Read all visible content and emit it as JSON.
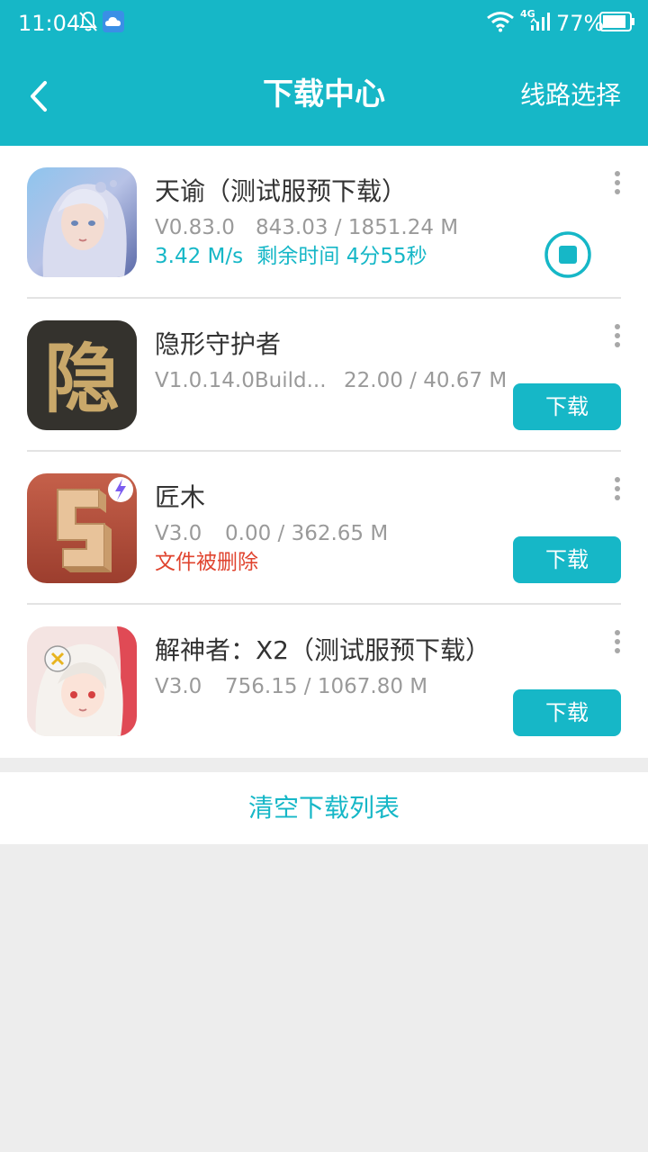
{
  "status_bar": {
    "time": "11:04",
    "network": "4G",
    "battery": "77%"
  },
  "header": {
    "title": "下载中心",
    "route_select": "线路选择"
  },
  "downloads": [
    {
      "name": "天谕（测试服预下载）",
      "version": "V0.83.0",
      "size": "843.03 / 1851.24 M",
      "speed": "3.42 M/s",
      "remaining": "剩余时间 4分55秒"
    },
    {
      "name": "隐形守护者",
      "version": "V1.0.14.0Build...",
      "size": "22.00 / 40.67 M",
      "button": "下载",
      "icon_glyph": "隐"
    },
    {
      "name": "匠木",
      "version": "V3.0",
      "size": "0.00 / 362.65 M",
      "status": "文件被删除",
      "button": "下载"
    },
    {
      "name": "解神者：X2（测试服预下载）",
      "version": "V3.0",
      "size": "756.15 / 1067.80 M",
      "button": "下载"
    }
  ],
  "footer": {
    "clear_label": "清空下载列表"
  },
  "colors": {
    "accent": "#16b7c7",
    "error": "#e0442f",
    "muted": "#9a9a9a"
  }
}
